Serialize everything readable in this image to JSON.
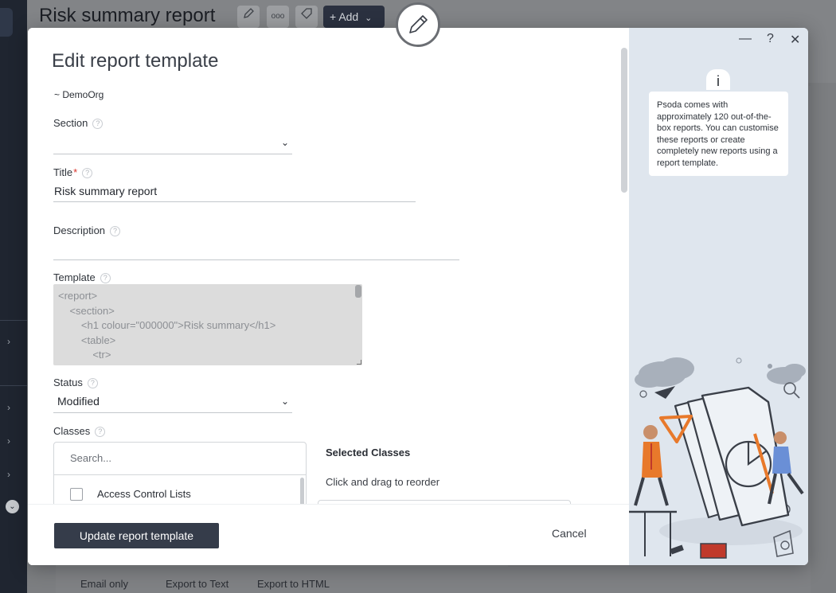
{
  "background": {
    "page_title": "Risk summary report",
    "add_label": "Add",
    "footer_items": [
      "Email only",
      "Export to Text",
      "Export to HTML"
    ]
  },
  "modal": {
    "title": "Edit report template",
    "org": "~ DemoOrg",
    "section": {
      "label": "Section",
      "value": ""
    },
    "title_field": {
      "label": "Title",
      "value": "Risk summary report"
    },
    "description": {
      "label": "Description",
      "value": ""
    },
    "template": {
      "label": "Template",
      "lines": [
        "<report>",
        "    <section>",
        "        <h1 colour=\"000000\">Risk summary</h1>",
        "        <table>",
        "            <tr>"
      ]
    },
    "status": {
      "label": "Status",
      "value": "Modified"
    },
    "classes": {
      "label": "Classes",
      "search_placeholder": "Search...",
      "items": [
        "Access Control Lists"
      ],
      "selected_title": "Selected Classes",
      "selected_hint": "Click and drag to reorder"
    },
    "update_button": "Update report template",
    "cancel_button": "Cancel",
    "window_controls": {
      "minimize": "—",
      "help": "?",
      "close": "✕"
    },
    "info": {
      "icon_label": "i",
      "text": "Psoda comes with approximately 120 out-of-the-box reports. You can customise these reports or create completely new reports using a report template."
    }
  },
  "colors": {
    "primary_button": "#353c4a",
    "side_panel": "#dfe6ee",
    "required_star": "#d9342b",
    "accent_orange": "#e8792b"
  }
}
